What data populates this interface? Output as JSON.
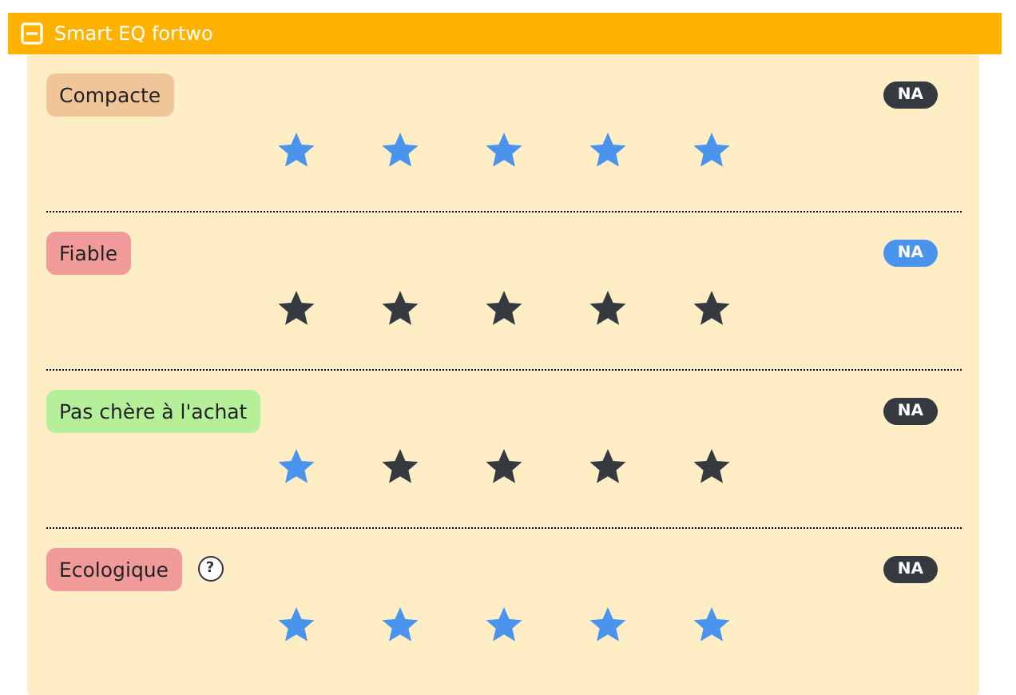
{
  "panel": {
    "title": "Smart EQ fortwo",
    "expanded": true
  },
  "criteria": [
    {
      "label": "Compacte",
      "color": "#f0c59a",
      "help": false,
      "badge": "NA",
      "highlighted": false,
      "rating": [
        {
          "selected": true
        },
        {
          "selected": true
        },
        {
          "selected": true
        },
        {
          "selected": true
        },
        {
          "selected": true
        }
      ]
    },
    {
      "label": "Fiable",
      "color": "#f09a9a",
      "help": false,
      "badge": "NA",
      "highlighted": true,
      "rating": [
        {
          "selected": false
        },
        {
          "selected": false
        },
        {
          "selected": false
        },
        {
          "selected": false
        },
        {
          "selected": false
        }
      ]
    },
    {
      "label": "Pas chère à l'achat",
      "color": "#b5ef9a",
      "help": false,
      "badge": "NA",
      "highlighted": false,
      "rating": [
        {
          "selected": true
        },
        {
          "selected": false
        },
        {
          "selected": false
        },
        {
          "selected": false
        },
        {
          "selected": false
        }
      ]
    },
    {
      "label": "Ecologique",
      "color": "#f09a9a",
      "help": true,
      "help_text": "?",
      "badge": "NA",
      "highlighted": false,
      "rating": [
        {
          "selected": true
        },
        {
          "selected": true
        },
        {
          "selected": true
        },
        {
          "selected": true
        },
        {
          "selected": true
        }
      ]
    }
  ]
}
